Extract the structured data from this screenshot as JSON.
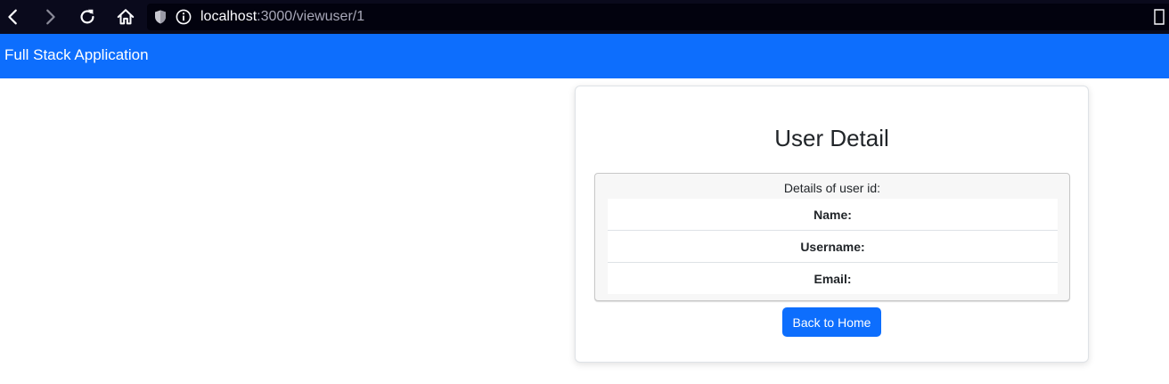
{
  "browser": {
    "url_host": "localhost",
    "url_path": ":3000/viewuser/1"
  },
  "navbar": {
    "brand": "Full Stack Application"
  },
  "card": {
    "title": "User Detail",
    "details_header": "Details of user id:",
    "fields": [
      {
        "label": "Name:"
      },
      {
        "label": "Username:"
      },
      {
        "label": "Email:"
      }
    ],
    "back_button": "Back to Home"
  },
  "colors": {
    "navbar": "#0d6efd",
    "button": "#0d6efd",
    "browser_chrome": "#0a0a1c"
  }
}
